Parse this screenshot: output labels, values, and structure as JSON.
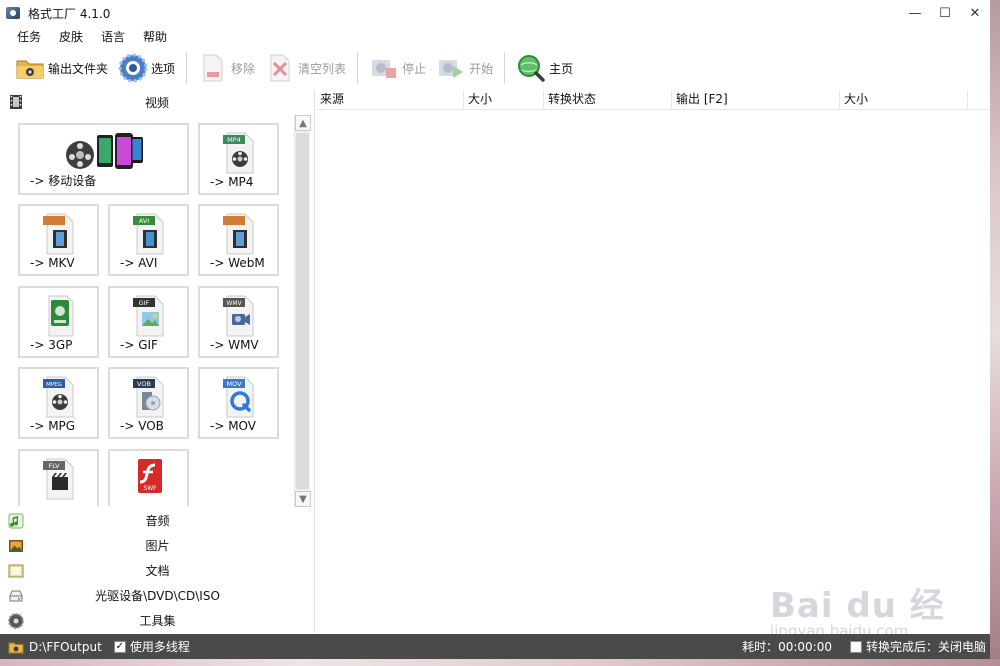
{
  "window": {
    "title": "格式工厂 4.1.0",
    "controls": [
      "—",
      "☐",
      "✕"
    ]
  },
  "menu": [
    "任务",
    "皮肤",
    "语言",
    "帮助"
  ],
  "toolbar": {
    "output_folder": "输出文件夹",
    "options": "选项",
    "remove": "移除",
    "clear_list": "清空列表",
    "stop": "停止",
    "start": "开始",
    "home": "主页"
  },
  "left": {
    "video_header": "视频",
    "tiles": [
      {
        "label": "-> 移动设备"
      },
      {
        "label": "-> MP4",
        "badge": "MP4",
        "badge_color": "#3a8a5a"
      },
      {
        "label": "-> MKV",
        "badge": "",
        "badge_color": "#d27c38"
      },
      {
        "label": "-> AVI",
        "badge": "AVI",
        "badge_color": "#3c8b3a"
      },
      {
        "label": "-> WebM",
        "badge": "",
        "badge_color": "#d27c38"
      },
      {
        "label": "-> 3GP",
        "badge": "",
        "badge_color": "#2e8a3b"
      },
      {
        "label": "-> GIF",
        "badge": "GIF",
        "badge_color": "#333333"
      },
      {
        "label": "-> WMV",
        "badge": "WMV",
        "badge_color": "#555555"
      },
      {
        "label": "-> MPG",
        "badge": "MPEG",
        "badge_color": "#2b5fa8"
      },
      {
        "label": "-> VOB",
        "badge": "VOB",
        "badge_color": "#2b3d55"
      },
      {
        "label": "-> MOV",
        "badge": "MOV",
        "badge_color": "#3a78c8"
      },
      {
        "label": "",
        "badge": "FLV",
        "badge_color": "#666666"
      },
      {
        "label": "",
        "badge": "SWF",
        "badge_color": "#d42a2a"
      }
    ],
    "categories": [
      "音频",
      "图片",
      "文档",
      "光驱设备\\DVD\\CD\\ISO",
      "工具集"
    ]
  },
  "list": {
    "columns": [
      "来源",
      "大小",
      "转换状态",
      "输出 [F2]",
      "大小"
    ]
  },
  "status": {
    "output_path": "D:\\FFOutput",
    "multithread_label": "使用多线程",
    "multithread_checked": true,
    "time_label": "耗时：00:00:00",
    "after_done_label": "转换完成后：关闭电脑",
    "after_done_checked": false
  },
  "watermark": {
    "brand": "Bai du 经验",
    "url": "jingyan.baidu.com"
  }
}
